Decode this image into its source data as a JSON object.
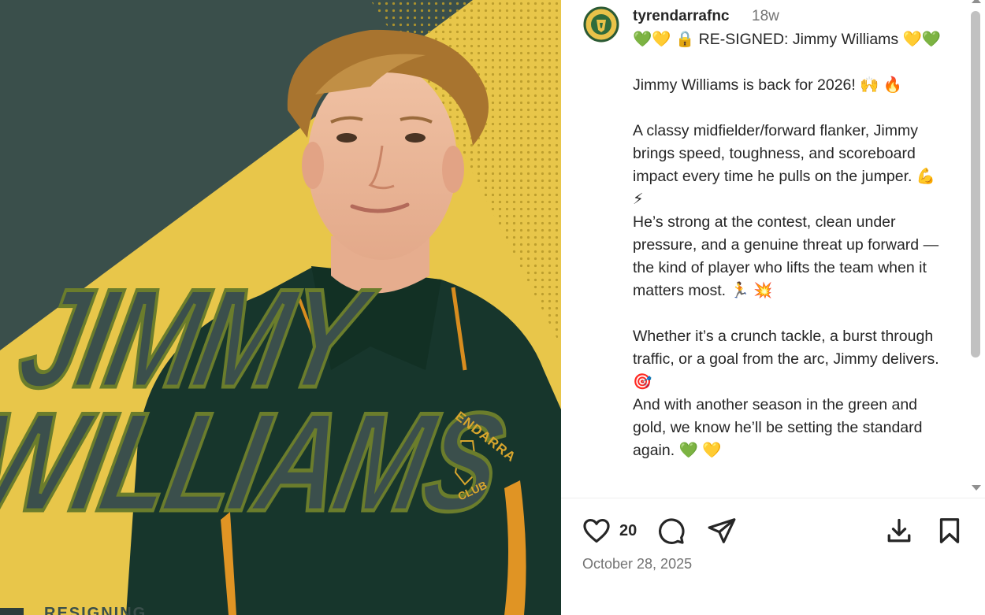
{
  "media": {
    "name_line1": "JIMMY",
    "name_line2": "WILLIAMS",
    "shirt_crest_top": "ENDARRA",
    "shirt_crest_bottom": "CLUB",
    "bottom_tag": "RESIGNING",
    "colors": {
      "dark_green": "#3a4f4b",
      "gold": "#e8c64a",
      "jersey": "#17362c",
      "trim": "#d98d1f"
    }
  },
  "post": {
    "username": "tyrendarrafnc",
    "time_ago": "18w",
    "caption": "💚💛 🔒 RE-SIGNED: Jimmy Williams 💛💚\n\nJimmy Williams is back for 2026! 🙌 🔥\n\nA classy midfielder/forward flanker, Jimmy brings speed, toughness, and scoreboard impact every time he pulls on the jumper. 💪 ⚡\nHe’s strong at the contest, clean under pressure, and a genuine threat up forward — the kind of player who lifts the team when it matters most. 🏃 💥\n\nWhether it’s a crunch tackle, a burst through traffic, or a goal from the arc, Jimmy delivers. 🎯\nAnd with another season in the green and gold, we know he’ll be setting the standard again. 💚 💛",
    "likes": "20",
    "date": "October 28, 2025"
  },
  "icons": [
    "heart-icon",
    "comment-icon",
    "share-icon",
    "download-icon",
    "bookmark-icon"
  ]
}
